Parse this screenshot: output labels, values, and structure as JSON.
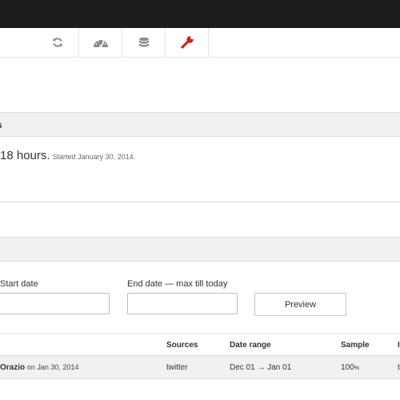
{
  "toolbar": {
    "icons": [
      "sync-icon",
      "speedometer-icon",
      "database-icon",
      "wrench-icon"
    ],
    "active_color": "#c8261a",
    "icon_color": "#8a8a8a"
  },
  "section1": {
    "title": "s"
  },
  "status": {
    "duration": "18 hours.",
    "started": "Started January 30, 2014."
  },
  "form": {
    "start_label": "Start date",
    "end_label": "End date — max till today",
    "start_value": "",
    "end_value": "",
    "preview_label": "Preview"
  },
  "table": {
    "columns": [
      "Sources",
      "Date range",
      "Sample",
      "I"
    ],
    "rows": [
      {
        "author": "Orazio",
        "date_prefix": "on Jan 30, 2014",
        "source": "twitter",
        "range": "Dec 01 → Jan 01",
        "sample": "100",
        "sample_unit": "%",
        "extra": "t"
      }
    ]
  }
}
